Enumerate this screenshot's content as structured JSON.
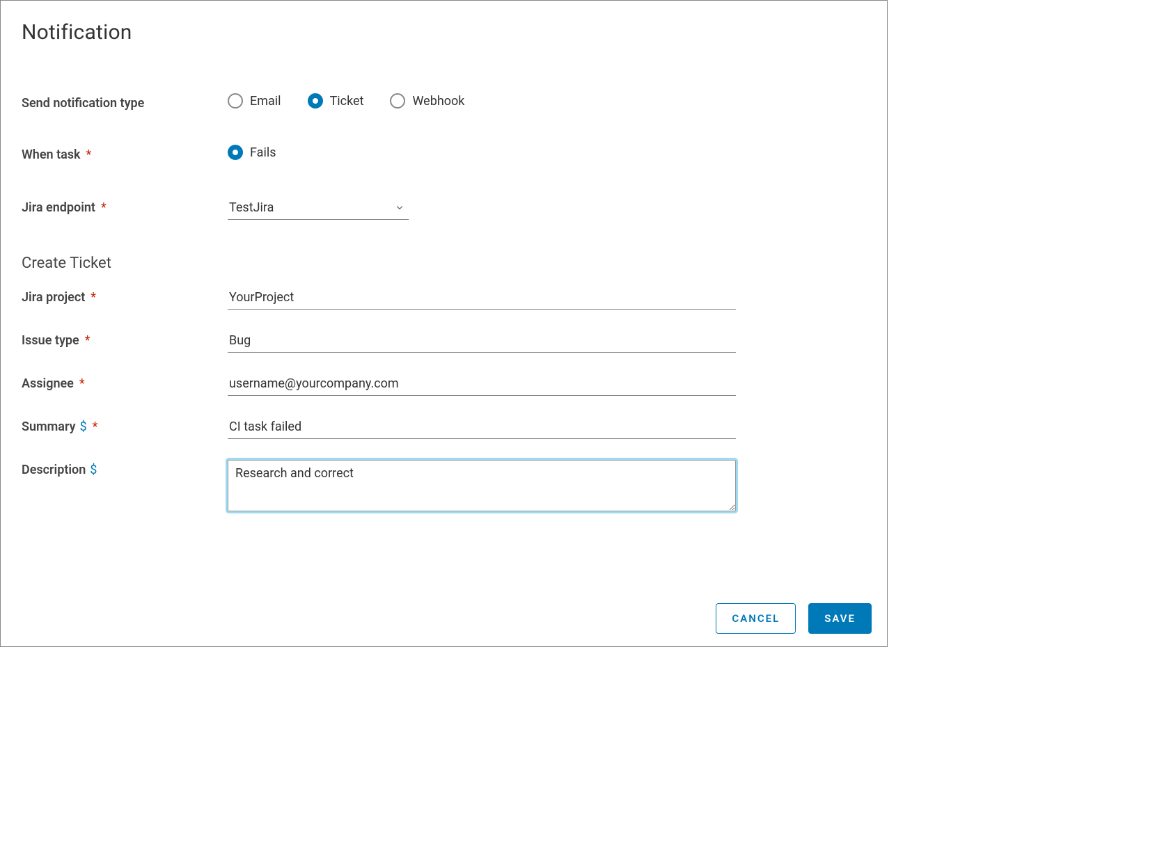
{
  "title": "Notification",
  "labels": {
    "send_type": "Send notification type",
    "when_task": "When task",
    "jira_endpoint": "Jira endpoint",
    "create_ticket": "Create Ticket",
    "jira_project": "Jira project",
    "issue_type": "Issue type",
    "assignee": "Assignee",
    "summary": "Summary",
    "description": "Description"
  },
  "send_type_options": {
    "email": "Email",
    "ticket": "Ticket",
    "webhook": "Webhook"
  },
  "when_task_options": {
    "fails": "Fails"
  },
  "values": {
    "jira_endpoint": "TestJira",
    "jira_project": "YourProject",
    "issue_type": "Bug",
    "assignee": "username@yourcompany.com",
    "summary": "CI task failed",
    "description": "Research and correct"
  },
  "buttons": {
    "cancel": "CANCEL",
    "save": "SAVE"
  },
  "glyphs": {
    "required": "*",
    "dollar": "$"
  }
}
